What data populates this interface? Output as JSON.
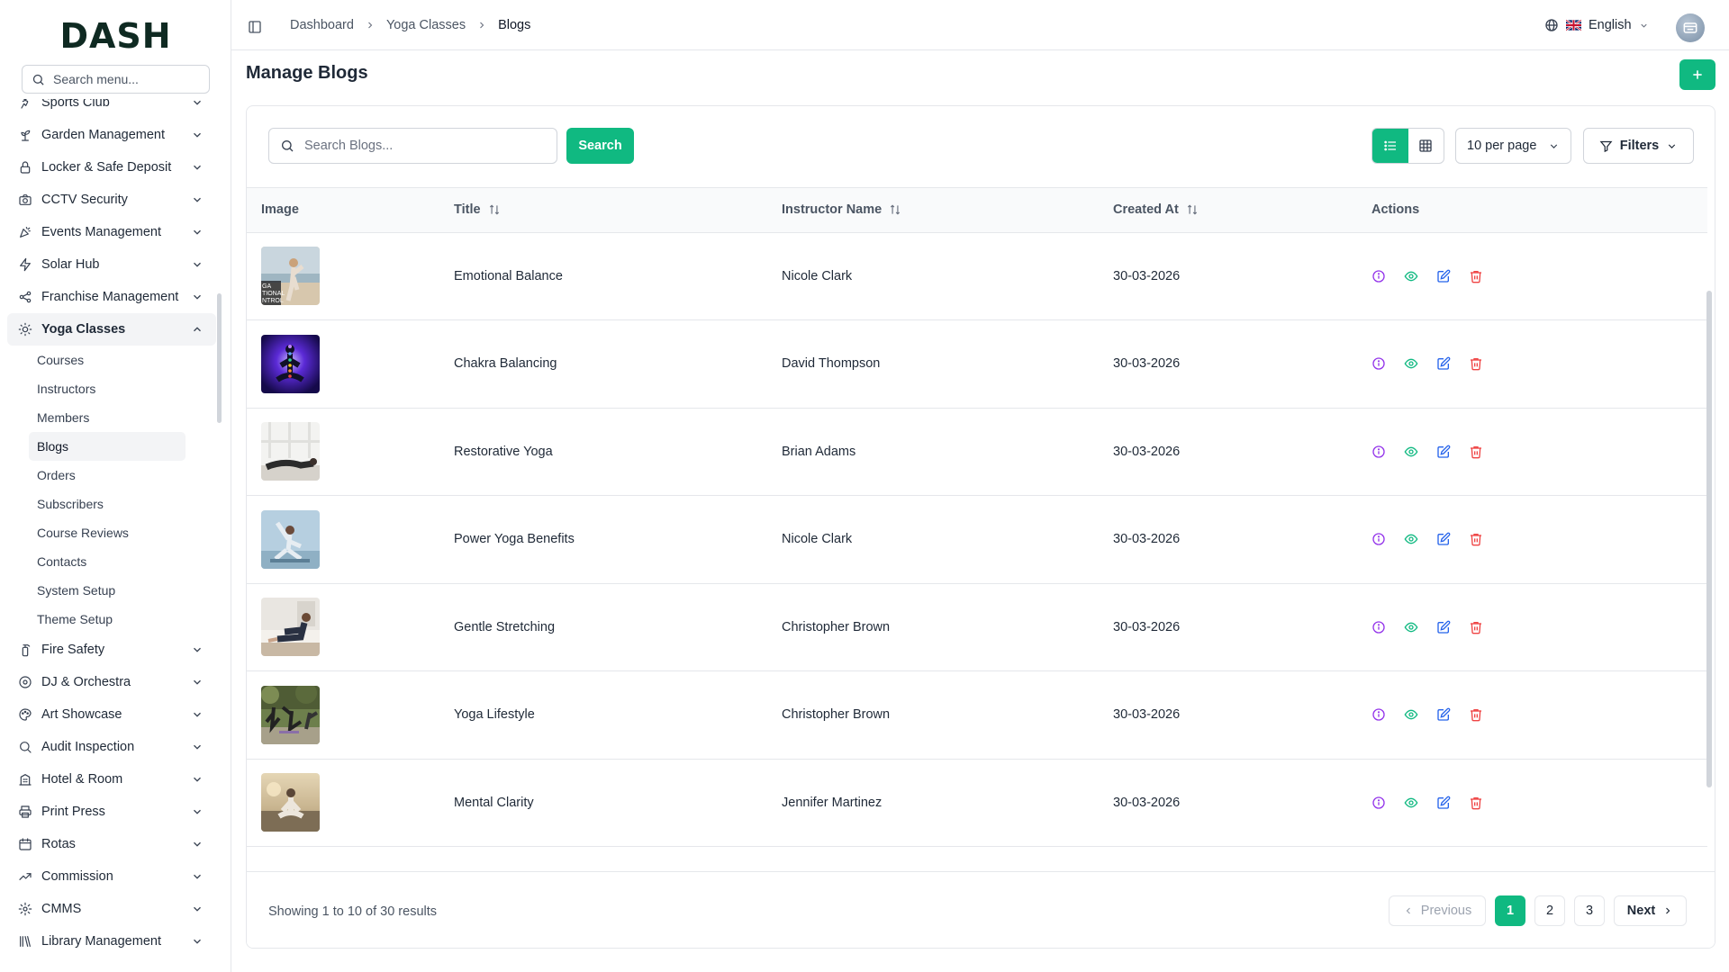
{
  "app": {
    "logo": "DASH"
  },
  "sidebar": {
    "search_placeholder": "Search menu...",
    "items": [
      {
        "label": "Sports Club",
        "icon": "sports-icon"
      },
      {
        "label": "Garden Management",
        "icon": "plant-icon"
      },
      {
        "label": "Locker & Safe Deposit",
        "icon": "lock-icon"
      },
      {
        "label": "CCTV Security",
        "icon": "camera-icon"
      },
      {
        "label": "Events Management",
        "icon": "party-icon"
      },
      {
        "label": "Solar Hub",
        "icon": "bolt-icon"
      },
      {
        "label": "Franchise Management",
        "icon": "share-icon"
      },
      {
        "label": "Yoga Classes",
        "icon": "sun-icon",
        "expanded": true
      },
      {
        "label": "Fire Safety",
        "icon": "extinguisher-icon"
      },
      {
        "label": "DJ & Orchestra",
        "icon": "disc-icon"
      },
      {
        "label": "Art Showcase",
        "icon": "palette-icon"
      },
      {
        "label": "Audit Inspection",
        "icon": "search-check-icon"
      },
      {
        "label": "Hotel & Room",
        "icon": "hotel-icon"
      },
      {
        "label": "Print Press",
        "icon": "printer-icon"
      },
      {
        "label": "Rotas",
        "icon": "calendar-icon"
      },
      {
        "label": "Commission",
        "icon": "trend-icon"
      },
      {
        "label": "CMMS",
        "icon": "cog-icon"
      },
      {
        "label": "Library Management",
        "icon": "library-icon"
      }
    ],
    "yoga_sub": [
      "Courses",
      "Instructors",
      "Members",
      "Blogs",
      "Orders",
      "Subscribers",
      "Course Reviews",
      "Contacts",
      "System Setup",
      "Theme Setup"
    ],
    "active_sub": "Blogs"
  },
  "header": {
    "breadcrumb": [
      "Dashboard",
      "Yoga Classes",
      "Blogs"
    ],
    "language": "English"
  },
  "page": {
    "title": "Manage Blogs"
  },
  "toolbar": {
    "search_placeholder": "Search Blogs...",
    "search_button": "Search",
    "per_page": "10 per page",
    "filters": "Filters"
  },
  "table": {
    "columns": [
      "Image",
      "Title",
      "Instructor Name",
      "Created At",
      "Actions"
    ],
    "rows": [
      {
        "title": "Emotional Balance",
        "instructor": "Nicole Clark",
        "created_at": "30-03-2026",
        "thumb": "beach"
      },
      {
        "title": "Chakra Balancing",
        "instructor": "David Thompson",
        "created_at": "30-03-2026",
        "thumb": "chakra"
      },
      {
        "title": "Restorative Yoga",
        "instructor": "Brian Adams",
        "created_at": "30-03-2026",
        "thumb": "studio"
      },
      {
        "title": "Power Yoga Benefits",
        "instructor": "Nicole Clark",
        "created_at": "30-03-2026",
        "thumb": "stretch"
      },
      {
        "title": "Gentle Stretching",
        "instructor": "Christopher Brown",
        "created_at": "30-03-2026",
        "thumb": "floor"
      },
      {
        "title": "Yoga Lifestyle",
        "instructor": "Christopher Brown",
        "created_at": "30-03-2026",
        "thumb": "park"
      },
      {
        "title": "Mental Clarity",
        "instructor": "Jennifer Martinez",
        "created_at": "30-03-2026",
        "thumb": "lotus"
      }
    ]
  },
  "footer": {
    "showing": "Showing 1 to 10 of 30 results",
    "previous": "Previous",
    "pages": [
      "1",
      "2",
      "3"
    ],
    "current_page": "1",
    "next": "Next"
  },
  "colors": {
    "accent": "#10b981"
  }
}
